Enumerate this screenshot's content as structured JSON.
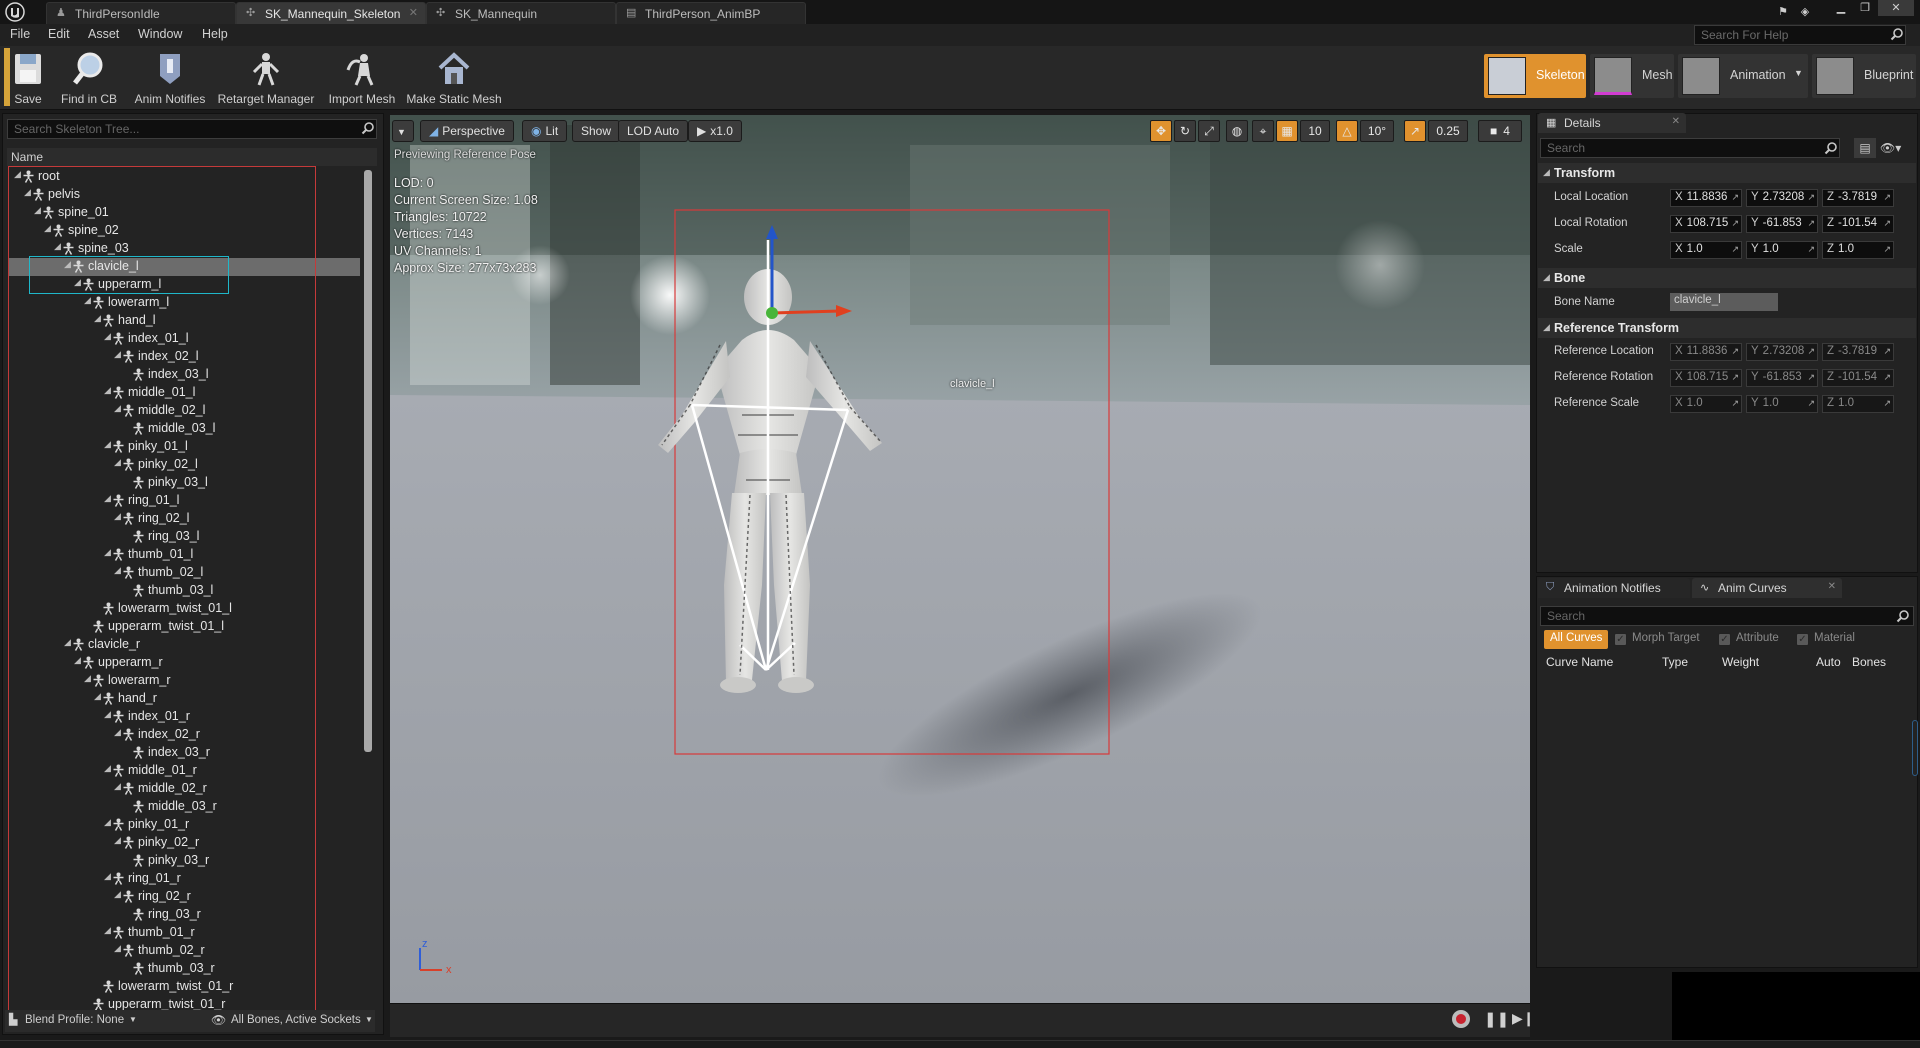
{
  "window": {
    "tabs": [
      {
        "label": "ThirdPersonIdle"
      },
      {
        "label": "SK_Mannequin_Skeleton"
      },
      {
        "label": "SK_Mannequin"
      },
      {
        "label": "ThirdPerson_AnimBP"
      }
    ],
    "help_search_placeholder": "Search For Help"
  },
  "menu": {
    "items": [
      "File",
      "Edit",
      "Asset",
      "Window",
      "Help"
    ]
  },
  "toolbar": {
    "buttons": [
      "Save",
      "Find in CB",
      "Anim Notifies",
      "Retarget Manager",
      "Import Mesh",
      "Make Static Mesh"
    ],
    "modes": [
      "Skeleton",
      "Mesh",
      "Animation",
      "Blueprint"
    ],
    "active_mode": "Skeleton"
  },
  "skeleton_tree": {
    "search_placeholder": "Search Skeleton Tree...",
    "column_header": "Name",
    "selected": "clavicle_l",
    "bones": [
      {
        "name": "root",
        "depth": 0
      },
      {
        "name": "pelvis",
        "depth": 1
      },
      {
        "name": "spine_01",
        "depth": 2
      },
      {
        "name": "spine_02",
        "depth": 3
      },
      {
        "name": "spine_03",
        "depth": 4
      },
      {
        "name": "clavicle_l",
        "depth": 5
      },
      {
        "name": "upperarm_l",
        "depth": 6
      },
      {
        "name": "lowerarm_l",
        "depth": 7
      },
      {
        "name": "hand_l",
        "depth": 8
      },
      {
        "name": "index_01_l",
        "depth": 9
      },
      {
        "name": "index_02_l",
        "depth": 10
      },
      {
        "name": "index_03_l",
        "depth": 11
      },
      {
        "name": "middle_01_l",
        "depth": 9
      },
      {
        "name": "middle_02_l",
        "depth": 10
      },
      {
        "name": "middle_03_l",
        "depth": 11
      },
      {
        "name": "pinky_01_l",
        "depth": 9
      },
      {
        "name": "pinky_02_l",
        "depth": 10
      },
      {
        "name": "pinky_03_l",
        "depth": 11
      },
      {
        "name": "ring_01_l",
        "depth": 9
      },
      {
        "name": "ring_02_l",
        "depth": 10
      },
      {
        "name": "ring_03_l",
        "depth": 11
      },
      {
        "name": "thumb_01_l",
        "depth": 9
      },
      {
        "name": "thumb_02_l",
        "depth": 10
      },
      {
        "name": "thumb_03_l",
        "depth": 11
      },
      {
        "name": "lowerarm_twist_01_l",
        "depth": 8
      },
      {
        "name": "upperarm_twist_01_l",
        "depth": 7
      },
      {
        "name": "clavicle_r",
        "depth": 5
      },
      {
        "name": "upperarm_r",
        "depth": 6
      },
      {
        "name": "lowerarm_r",
        "depth": 7
      },
      {
        "name": "hand_r",
        "depth": 8
      },
      {
        "name": "index_01_r",
        "depth": 9
      },
      {
        "name": "index_02_r",
        "depth": 10
      },
      {
        "name": "index_03_r",
        "depth": 11
      },
      {
        "name": "middle_01_r",
        "depth": 9
      },
      {
        "name": "middle_02_r",
        "depth": 10
      },
      {
        "name": "middle_03_r",
        "depth": 11
      },
      {
        "name": "pinky_01_r",
        "depth": 9
      },
      {
        "name": "pinky_02_r",
        "depth": 10
      },
      {
        "name": "pinky_03_r",
        "depth": 11
      },
      {
        "name": "ring_01_r",
        "depth": 9
      },
      {
        "name": "ring_02_r",
        "depth": 10
      },
      {
        "name": "ring_03_r",
        "depth": 11
      },
      {
        "name": "thumb_01_r",
        "depth": 9
      },
      {
        "name": "thumb_02_r",
        "depth": 10
      },
      {
        "name": "thumb_03_r",
        "depth": 11
      },
      {
        "name": "lowerarm_twist_01_r",
        "depth": 8
      },
      {
        "name": "upperarm_twist_01_r",
        "depth": 7
      }
    ],
    "blend_profile": "Blend Profile: None",
    "filter": "All Bones, Active Sockets"
  },
  "viewport": {
    "view_mode": "Perspective",
    "lighting": "Lit",
    "show_label": "Show",
    "lod": "LOD Auto",
    "play_speed": "x1.0",
    "preview_notice": "Previewing Reference Pose",
    "stats": [
      "LOD: 0",
      "Current Screen Size: 1.08",
      "Triangles: 10722",
      "Vertices: 7143",
      "UV Channels: 1",
      "Approx Size: 277x73x283"
    ],
    "grid_snap": "10",
    "rotation_snap": "10°",
    "scale_snap": "0.25",
    "camera_speed": "4",
    "bone_label": "clavicle_l",
    "axis_z": "z",
    "axis_x": "x"
  },
  "details": {
    "tab_label": "Details",
    "search_placeholder": "Search",
    "sections": {
      "transform": "Transform",
      "bone": "Bone",
      "reference_transform": "Reference Transform"
    },
    "transform": [
      {
        "label": "Local Location",
        "x": "11.8836",
        "y": "2.73208",
        "z": "-3.7819"
      },
      {
        "label": "Local Rotation",
        "x": "108.715",
        "y": "-61.853",
        "z": "-101.54"
      },
      {
        "label": "Scale",
        "x": "1.0",
        "y": "1.0",
        "z": "1.0"
      }
    ],
    "bone_name_label": "Bone Name",
    "bone_name_value": "clavicle_l",
    "reference": [
      {
        "label": "Reference Location",
        "x": "11.8836",
        "y": "2.73208",
        "z": "-3.7819"
      },
      {
        "label": "Reference Rotation",
        "x": "108.715",
        "y": "-61.853",
        "z": "-101.54"
      },
      {
        "label": "Reference Scale",
        "x": "1.0",
        "y": "1.0",
        "z": "1.0"
      }
    ]
  },
  "curves": {
    "tabs": [
      "Animation Notifies",
      "Anim Curves"
    ],
    "search_placeholder": "Search",
    "filters": [
      "All Curves",
      "Morph Target",
      "Attribute",
      "Material"
    ],
    "columns": [
      "Curve Name",
      "Type",
      "Weight",
      "Auto",
      "Bones"
    ]
  },
  "colors": {
    "accent_orange": "#e0922e",
    "selection_cyan": "#1fb7c9",
    "bounds_red": "#d83a3a"
  }
}
